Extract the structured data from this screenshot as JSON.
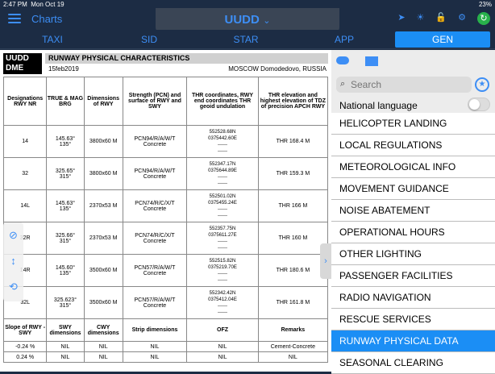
{
  "status": {
    "time": "2:47 PM",
    "date": "Mon Oct 19",
    "battery": "23%"
  },
  "topbar": {
    "charts_label": "Charts",
    "airport": "UUDD",
    "airport_chevron": "⌄"
  },
  "tabs": [
    "TAXI",
    "SID",
    "STAR",
    "APP",
    "GEN"
  ],
  "doc": {
    "logo_line1": "UUDD",
    "logo_line2": "DME",
    "title": "RUNWAY PHYSICAL CHARACTERISTICS",
    "date": "15feb2019",
    "place": "MOSCOW Domodedovo, RUSSIA",
    "headers": [
      "Designations RWY NR",
      "TRUE & MAG BRG",
      "Dimensions of RWY",
      "Strength (PCN) and surface of RWY and SWY",
      "THR coordinates, RWY end coordinates THR geoid undulation",
      "THR elevation and highest elevation of TDZ of precision APCH RWY"
    ],
    "rows": [
      [
        "14",
        "145.63°\n135°",
        "3800x60 M",
        "PCN94/R/A/W/T\nConcrete",
        "552528.68N\n0375442.60E\n------\n------",
        "THR 168.4 M"
      ],
      [
        "32",
        "325.65°\n315°",
        "3800x60 M",
        "PCN94/R/A/W/T\nConcrete",
        "552347.17N\n0375644.89E\n------\n------",
        "THR 159.3 M"
      ],
      [
        "14L",
        "145.63°\n135°",
        "2370x53 M",
        "PCN74/R/C/X/T\nConcrete",
        "552501.02N\n0375455.24E\n------\n------",
        "THR 166 M"
      ],
      [
        "32R",
        "325.66°\n315°",
        "2370x53 M",
        "PCN74/R/C/X/T\nConcrete",
        "552357.75N\n0375611.27E\n------\n------",
        "THR 160 M"
      ],
      [
        "14R",
        "145.60°\n135°",
        "3500x60 M",
        "PCN57/R/A/W/T\nConcrete",
        "552515.82N\n0375219.70E\n------\n------",
        "THR 180.6 M"
      ],
      [
        "32L",
        "325.623°\n315°",
        "3500x60 M",
        "PCN57/R/A/W/T\nConcrete",
        "552342.42N\n0375412.04E\n------\n------",
        "THR 161.8 M"
      ]
    ],
    "sub_headers": [
      "Slope of RWY - SWY",
      "SWY dimensions",
      "CWY dimensions",
      "Strip dimensions",
      "OFZ",
      "Remarks"
    ],
    "sub_rows": [
      [
        "-0.24 %",
        "NIL",
        "NIL",
        "NIL",
        "NIL",
        "Cement-Concrete"
      ],
      [
        "0.24 %",
        "NIL",
        "NIL",
        "NIL",
        "NIL",
        "NIL"
      ]
    ]
  },
  "panel": {
    "search_placeholder": "Search",
    "language_label": "National language",
    "items": [
      "HELICOPTER LANDING",
      "LOCAL REGULATIONS",
      "METEOROLOGICAL INFO",
      "MOVEMENT GUIDANCE",
      "NOISE ABATEMENT",
      "OPERATIONAL HOURS",
      "OTHER LIGHTING",
      "PASSENGER FACILITIES",
      "RADIO NAVIGATION",
      "RESCUE SERVICES",
      "RUNWAY PHYSICAL DATA",
      "SEASONAL CLEARING"
    ],
    "active_item": "RUNWAY PHYSICAL DATA"
  },
  "colors": {
    "accent": "#1b8ef5",
    "background": "#1c2c44"
  }
}
